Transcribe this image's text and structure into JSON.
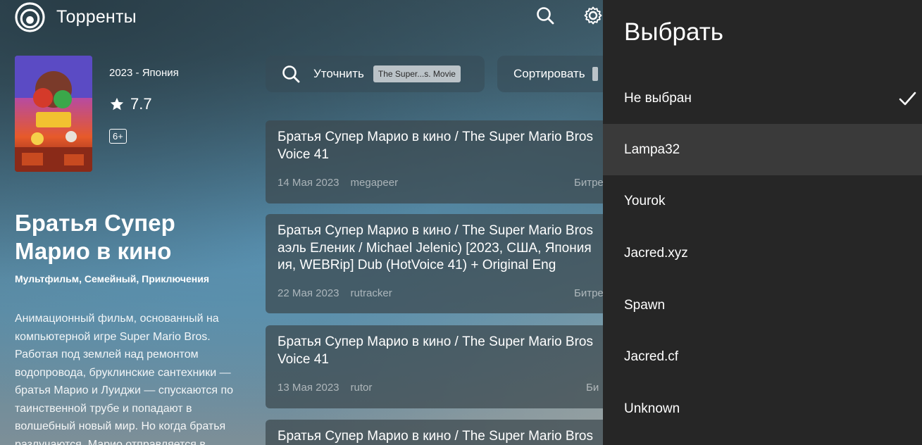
{
  "header": {
    "app_title": "Торренты"
  },
  "movie": {
    "year_country": "2023 - Япония",
    "rating": "7.7",
    "age_rating": "6+",
    "title": "Братья Супер Марио в кино",
    "genres": "Мультфильм, Семейный, Приключения",
    "description": "Анимационный фильм, основанный на компьютерной игре Super Mario Bros. Работая под землей над ремонтом водопровода, бруклинские сантехники — братья Марио и Луиджи — спускаются по таинственной трубе и попадают в волшебный новый мир. Но когда братья разлучаются, Марио отправляется в"
  },
  "filters": {
    "refine_label": "Уточнить",
    "refine_chip": "The Super...s. Movie",
    "sort_label": "Сортировать"
  },
  "torrents": [
    {
      "title": "Братья Супер Марио в кино / The Super Mario Bros\nVoice 41",
      "date": "14 Мая 2023",
      "source": "megapeer",
      "tracker": "Битре"
    },
    {
      "title": "Братья Супер Марио в кино / The Super Mario Bros\nаэль Еленик / Michael Jelenic) [2023, США, Япония\nия, WEBRip] Dub (HotVoice 41) + Original Eng",
      "date": "22 Мая 2023",
      "source": "rutracker",
      "tracker": "Битре"
    },
    {
      "title": "Братья Супер Марио в кино / The Super Mario Bros\nVoice 41",
      "date": "13 Мая 2023",
      "source": "rutor",
      "tracker": "Би"
    },
    {
      "title": "Братья Супер Марио в кино / The Super Mario Bros",
      "date": "",
      "source": "",
      "tracker": ""
    }
  ],
  "panel": {
    "title": "Выбрать",
    "items": [
      {
        "label": "Не выбран",
        "selected": true
      },
      {
        "label": "Lampa32",
        "focused": true
      },
      {
        "label": "Yourok"
      },
      {
        "label": "Jacred.xyz"
      },
      {
        "label": "Spawn"
      },
      {
        "label": "Jacred.cf"
      },
      {
        "label": "Unknown"
      }
    ]
  },
  "icons": {
    "logo": "lampa-logo-icon",
    "search": "search-icon",
    "settings": "gear-icon",
    "star": "star-icon",
    "check": "check-icon"
  }
}
